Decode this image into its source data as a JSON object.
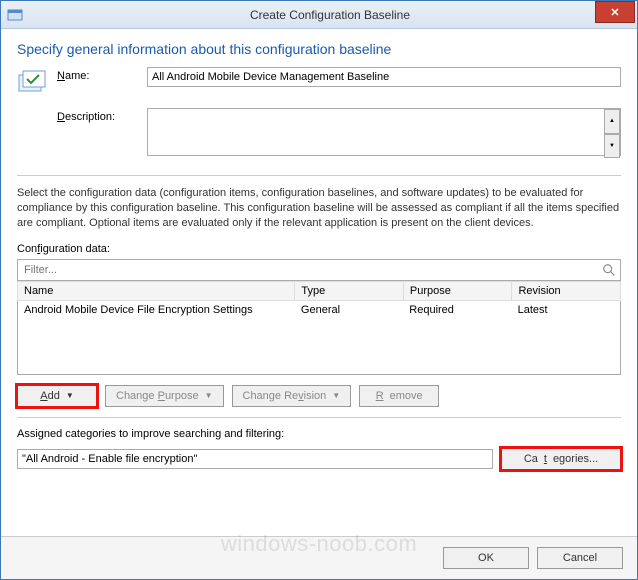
{
  "window": {
    "title": "Create Configuration Baseline",
    "close": "✕"
  },
  "heading": "Specify general information about this configuration baseline",
  "form": {
    "name_label": "Name:",
    "name_value": "All Android Mobile Device Management Baseline",
    "desc_label": "Description:",
    "desc_value": ""
  },
  "help_text": "Select the configuration data (configuration items, configuration baselines, and software updates) to be evaluated for compliance by this configuration baseline. This configuration baseline will be assessed as compliant if all the items specified are compliant. Optional items are evaluated only if the relevant application is present on  the client devices.",
  "config_data": {
    "label": "Configuration data:",
    "filter_placeholder": "Filter...",
    "columns": {
      "c0": "Name",
      "c1": "Type",
      "c2": "Purpose",
      "c3": "Revision"
    },
    "rows": [
      {
        "c0": "Android Mobile Device File Encryption Settings",
        "c1": "General",
        "c2": "Required",
        "c3": "Latest"
      }
    ]
  },
  "buttons": {
    "add": "Add",
    "change_purpose": "Change Purpose",
    "change_revision": "Change Revision",
    "remove": "Remove",
    "categories": "Categories...",
    "ok": "OK",
    "cancel": "Cancel"
  },
  "assigned": {
    "label": "Assigned categories to improve searching and filtering:",
    "value": "\"All Android - Enable file encryption\""
  },
  "watermark": "windows-noob.com"
}
